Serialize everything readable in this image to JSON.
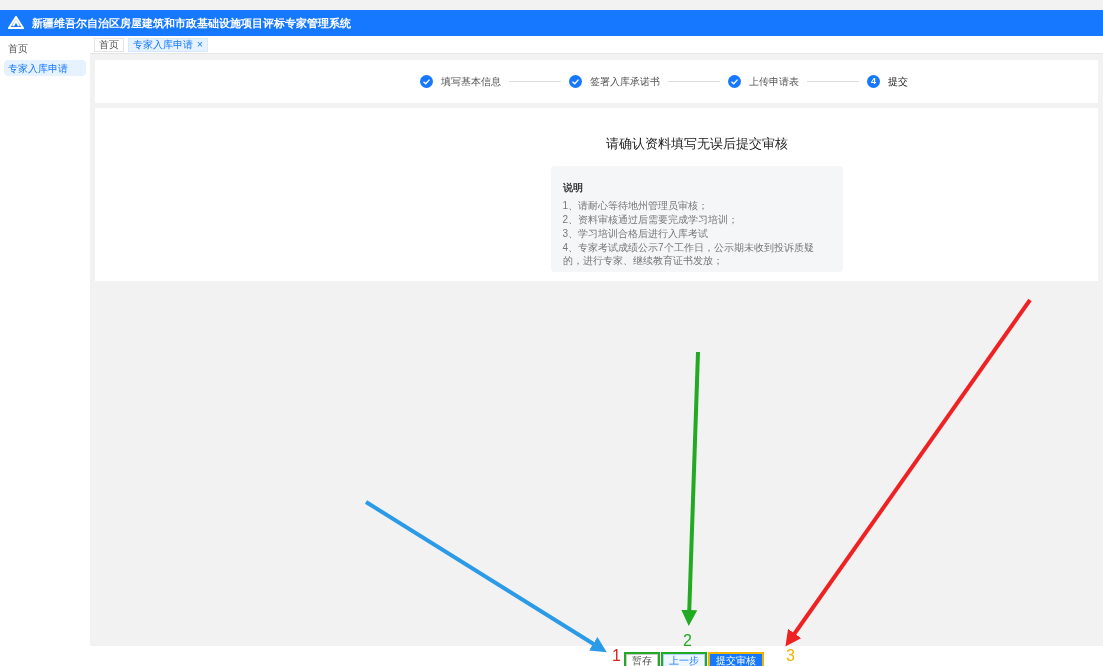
{
  "header": {
    "title": "新疆维吾尔自治区房屋建筑和市政基础设施项目评标专家管理系统"
  },
  "sidebar": {
    "items": [
      {
        "label": "首页",
        "selected": false
      },
      {
        "label": "专家入库申请",
        "selected": true
      }
    ]
  },
  "tabs": [
    {
      "label": "首页",
      "selected": false,
      "closable": false
    },
    {
      "label": "专家入库申请",
      "selected": true,
      "closable": true
    }
  ],
  "close_glyph": "×",
  "steps": [
    {
      "label": "填写基本信息",
      "done": true
    },
    {
      "label": "签署入库承诺书",
      "done": true
    },
    {
      "label": "上传申请表",
      "done": true
    },
    {
      "label": "提交",
      "done": false,
      "number": "4"
    }
  ],
  "content": {
    "heading": "请确认资料填写无误后提交审核",
    "notice": {
      "title": "说明",
      "lines": [
        "1、请耐心等待地州管理员审核；",
        "2、资料审核通过后需要完成学习培训；",
        "3、学习培训合格后进行入库考试",
        "4、专家考试成绩公示7个工作日，公示期未收到投诉质疑的，进行专家、继续教育证书发放；"
      ]
    }
  },
  "buttons": [
    {
      "label": "暂存",
      "kind": "default"
    },
    {
      "label": "上一步",
      "kind": "plain"
    },
    {
      "label": "提交审核",
      "kind": "primary"
    }
  ],
  "annotations": [
    {
      "label": "1",
      "color": "#e02020"
    },
    {
      "label": "2",
      "color": "#22aa22"
    },
    {
      "label": "3",
      "color": "#f0b400"
    }
  ]
}
